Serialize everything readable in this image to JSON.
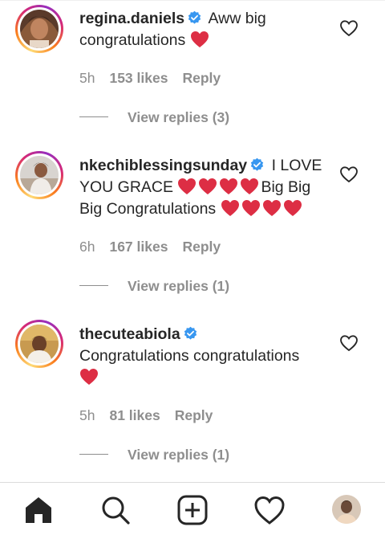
{
  "comments": [
    {
      "username": "regina.daniels",
      "text_parts": [
        "Aww big congratulations"
      ],
      "time": "5h",
      "likes": "153 likes",
      "reply": "Reply",
      "view_replies": "View replies (3)"
    },
    {
      "username": "nkechiblessingsunday",
      "text_parts": [
        "I LOVE YOU GRACE",
        "Big Big Big Congratulations"
      ],
      "time": "6h",
      "likes": "167 likes",
      "reply": "Reply",
      "view_replies": "View replies (1)"
    },
    {
      "username": "thecuteabiola",
      "text_parts": [
        "Congratulations congratulations"
      ],
      "time": "5h",
      "likes": "81 likes",
      "reply": "Reply",
      "view_replies": "View replies (1)"
    }
  ],
  "icons": {
    "verified": "verified-badge-icon",
    "heart_emoji": "red-heart-emoji",
    "like": "heart-outline-icon"
  },
  "colors": {
    "verified": "#3897f0",
    "heart_emoji": "#dd2e44",
    "muted_text": "#8e8e8e",
    "text": "#262626"
  },
  "tabbar": {
    "items": [
      "home-icon",
      "search-icon",
      "new-post-icon",
      "activity-icon",
      "profile-avatar"
    ]
  }
}
